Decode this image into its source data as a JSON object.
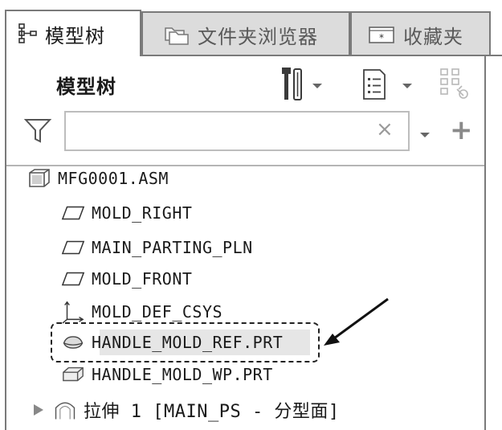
{
  "tabs": [
    {
      "label": "模型树",
      "icon": "model-tree-icon",
      "active": true
    },
    {
      "label": "文件夹浏览器",
      "icon": "folder-icon",
      "active": false
    },
    {
      "label": "收藏夹",
      "icon": "favorites-icon",
      "active": false
    }
  ],
  "panel": {
    "title": "模型树",
    "filter_placeholder": "",
    "clear_label": "×",
    "add_label": "+"
  },
  "tree": [
    {
      "label": "MFG0001.ASM",
      "icon": "assembly-icon"
    },
    {
      "label": "MOLD_RIGHT",
      "icon": "datum-plane-icon"
    },
    {
      "label": "MAIN_PARTING_PLN",
      "icon": "datum-plane-icon"
    },
    {
      "label": "MOLD_FRONT",
      "icon": "datum-plane-icon"
    },
    {
      "label": "MOLD_DEF_CSYS",
      "icon": "coordinate-system-icon"
    },
    {
      "label": "HANDLE_MOLD_REF.PRT",
      "icon": "reference-part-icon",
      "selected": true
    },
    {
      "label": "HANDLE_MOLD_WP.PRT",
      "icon": "workpiece-icon"
    },
    {
      "label": "拉伸 1 [MAIN_PS - 分型面]",
      "icon": "surface-icon",
      "expandable": true
    }
  ],
  "colors": {
    "border": "#7a7a7a",
    "selection": "#e6e6e6",
    "accent_red": "#c0392b"
  }
}
